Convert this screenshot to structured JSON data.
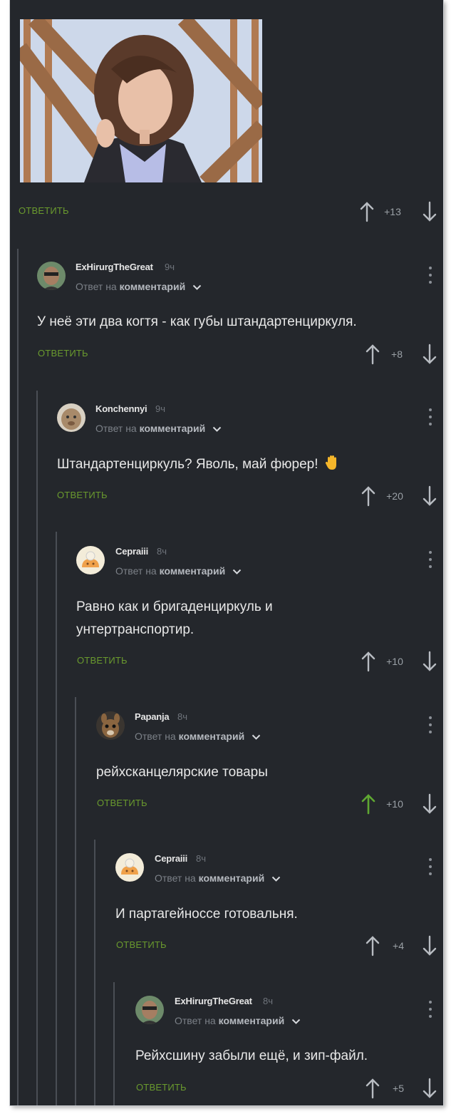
{
  "top": {
    "reply_label": "ОТВЕТИТЬ",
    "score": "+13"
  },
  "comments": [
    {
      "author": "ExHirurgTheGreat",
      "time": "9ч",
      "reply_prefix": "Ответ на",
      "reply_target": "комментарий",
      "text": "У неё эти два когтя - как губы штандартенциркуля.",
      "reply_label": "ОТВЕТИТЬ",
      "score": "+8"
    },
    {
      "author": "Konchennyi",
      "time": "9ч",
      "reply_prefix": "Ответ на",
      "reply_target": "комментарий",
      "text": "Штандартенциркуль? Яволь, май фюрер!",
      "reply_label": "ОТВЕТИТЬ",
      "score": "+20"
    },
    {
      "author": "Cepraiii",
      "time": "8ч",
      "reply_prefix": "Ответ на",
      "reply_target": "комментарий",
      "text_line1": "Равно как и бригаденциркуль и",
      "text_line2": "унтертранспортир.",
      "reply_label": "ОТВЕТИТЬ",
      "score": "+10"
    },
    {
      "author": "Papanja",
      "time": "8ч",
      "reply_prefix": "Ответ на",
      "reply_target": "комментарий",
      "text": "рейхсканцелярские товары",
      "reply_label": "ОТВЕТИТЬ",
      "score": "+10",
      "upvoted": true
    },
    {
      "author": "Cepraiii",
      "time": "8ч",
      "reply_prefix": "Ответ на",
      "reply_target": "комментарий",
      "text": "И партагейноссе готовальня.",
      "reply_label": "ОТВЕТИТЬ",
      "score": "+4"
    },
    {
      "author": "ExHirurgTheGreat",
      "time": "8ч",
      "reply_prefix": "Ответ на",
      "reply_target": "комментарий",
      "text": "Рейхсшину забыли ещё, и зип-файл.",
      "reply_label": "ОТВЕТИТЬ",
      "score": "+5"
    }
  ],
  "colors": {
    "background": "#24272c",
    "reply_green": "#6a9a2e",
    "upvote_active": "#5fa832",
    "thread_line": "#4a4e55",
    "text": "#e8e8e8",
    "muted": "#7c8188"
  },
  "icons": {
    "upvote": "arrow-up-icon",
    "downvote": "arrow-down-icon",
    "more": "kebab-menu-icon",
    "expand": "chevron-down-icon",
    "emoji": "raised-hand-emoji"
  }
}
